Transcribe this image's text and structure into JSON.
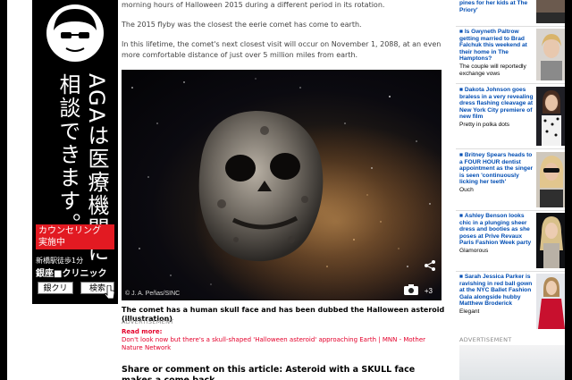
{
  "ad": {
    "vertical_col1": "AGAは医療機関に",
    "vertical_col2": "相談できます。",
    "red_line1": "カウンセリング",
    "red_line2": "実施中",
    "station": "新橋駅徒歩1分",
    "clinic": "銀座■クリニック",
    "search_left": "銀クリ",
    "search_right": "検索"
  },
  "article": {
    "para1": "morning hours of Halloween 2015 during a different period in its rotation.",
    "para2": "The 2015 flyby was the closest the eerie comet has come to earth.",
    "para3": "In this lifetime, the comet's next closest visit will occur on November 1, 2088, at an even more comfortable distance of just over 5 million miles from earth.",
    "photo_credit": "© J. A. Peñas/SINC",
    "photo_count": "+3",
    "caption": "The comet has a human skull face and has been dubbed the Halloween asteroid (illustration)",
    "advert_label": "ADVERTISEMENT",
    "read_more_label": "Read more:",
    "read_more_link": "Don't look now but there's a skull-shaped 'Halloween asteroid' approaching Earth | MNN - Mother Nature Network",
    "share_line": "Share or comment on this article: Asteroid with a SKULL face makes a come back"
  },
  "sidebar": {
    "stories": [
      {
        "head": "pines for her kids at The Priory'",
        "sub": ""
      },
      {
        "head": "Is Gwyneth Paltrow getting married to Brad Falchuk this weekend at their home in The Hamptons?",
        "sub": "The couple will reportedly exchange vows"
      },
      {
        "head": "Dakota Johnson goes braless in a very revealing dress flashing cleavage at New York City premiere of new film",
        "sub": "Pretty in polka dots"
      },
      {
        "head": "Britney Spears heads to a FOUR HOUR dentist appointment as the singer is seen 'continuously licking her teeth'",
        "sub": "Ouch"
      },
      {
        "head": "Ashley Benson looks chic in a plunging sheer dress and booties as she poses at Prive Revaux Paris Fashion Week party",
        "sub": "Glamorous"
      },
      {
        "head": "Sarah Jessica Parker is ravishing in red ball gown at the NYC Ballet Fashion Gala alongside hubby Matthew Broderick",
        "sub": "Elegant"
      }
    ],
    "advert_label": "ADVERTISEMENT"
  },
  "colors": {
    "link_blue": "#004db3",
    "accent_red": "#e4002b",
    "ad_red": "#e21a22"
  }
}
